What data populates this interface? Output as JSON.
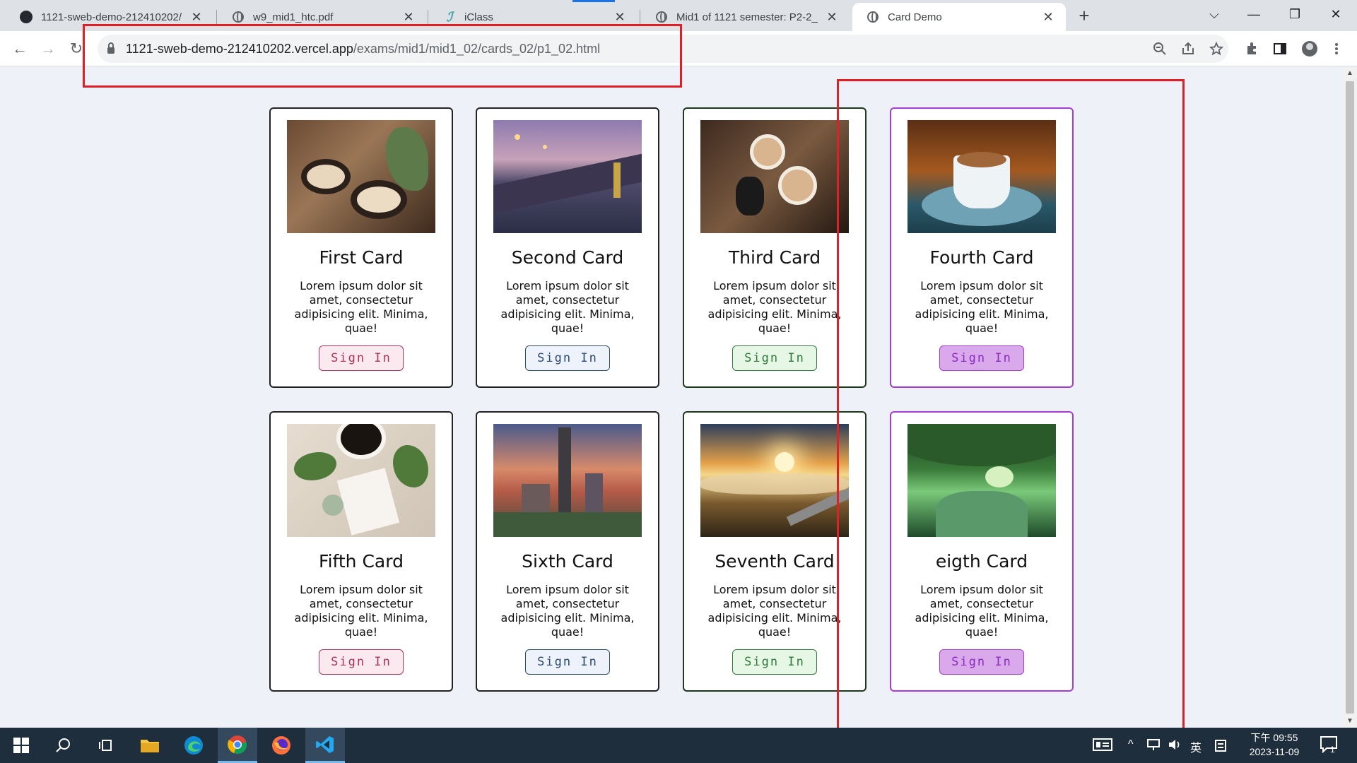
{
  "browser": {
    "tabs": [
      {
        "title": "1121-sweb-demo-212410202/",
        "icon": "github-icon",
        "close": "✕"
      },
      {
        "title": "w9_mid1_htc.pdf",
        "icon": "globe-icon",
        "close": "✕"
      },
      {
        "title": "iClass",
        "icon": "iclass-icon",
        "close": "✕"
      },
      {
        "title": "Mid1 of 1121 semester: P2-2_",
        "icon": "globe-icon",
        "close": "✕"
      },
      {
        "title": "Card Demo",
        "icon": "globe-icon",
        "close": "✕"
      }
    ],
    "new_tab": "+",
    "window_controls": {
      "dropdown": "⌵",
      "minimize": "—",
      "restore": "❐",
      "close": "✕"
    },
    "nav": {
      "back": "←",
      "forward": "→",
      "reload": "↻"
    },
    "url_host": "1121-sweb-demo-212410202.vercel.app",
    "url_path": "/exams/mid1/mid1_02/cards_02/p1_02.html",
    "toolbar_icons": [
      "zoom-icon",
      "share-icon",
      "star-icon",
      "extensions-icon",
      "sidepanel-icon",
      "profile-icon",
      "menu-icon"
    ]
  },
  "cards": [
    {
      "title": "First Card",
      "text": "Lorem ipsum dolor sit amet, consectetur adipisicing elit. Minima, quae!",
      "button": "Sign In",
      "variant": "pink",
      "photo": "coffee-cups"
    },
    {
      "title": "Second Card",
      "text": "Lorem ipsum dolor sit amet, consectetur adipisicing elit. Minima, quae!",
      "button": "Sign In",
      "variant": "blue",
      "photo": "bridge-evening"
    },
    {
      "title": "Third Card",
      "text": "Lorem ipsum dolor sit amet, consectetur adipisicing elit. Minima, quae!",
      "button": "Sign In",
      "variant": "green",
      "photo": "latte-toast"
    },
    {
      "title": "Fourth Card",
      "text": "Lorem ipsum dolor sit amet, consectetur adipisicing elit. Minima, quae!",
      "button": "Sign In",
      "variant": "purple",
      "photo": "coffee-cup-saucer"
    },
    {
      "title": "Fifth Card",
      "text": "Lorem ipsum dolor sit amet, consectetur adipisicing elit. Minima, quae!",
      "button": "Sign In",
      "variant": "pink",
      "photo": "coffee-flatlay"
    },
    {
      "title": "Sixth Card",
      "text": "Lorem ipsum dolor sit amet, consectetur adipisicing elit. Minima, quae!",
      "button": "Sign In",
      "variant": "blue",
      "photo": "city-skyline"
    },
    {
      "title": "Seventh Card",
      "text": "Lorem ipsum dolor sit amet, consectetur adipisicing elit. Minima, quae!",
      "button": "Sign In",
      "variant": "green",
      "photo": "mountain-sunrise"
    },
    {
      "title": "eigth Card",
      "text": "Lorem ipsum dolor sit amet, consectetur adipisicing elit. Minima, quae!",
      "button": "Sign In",
      "variant": "purple",
      "photo": "green-river"
    }
  ],
  "taskbar": {
    "apps": [
      "windows-start-icon",
      "search-icon",
      "task-view-icon",
      "file-explorer-icon",
      "edge-icon",
      "chrome-icon",
      "firefox-icon",
      "vscode-icon"
    ],
    "tray": {
      "ime_mode": "英",
      "chevron": "^"
    },
    "clock_time": "下午 09:55",
    "clock_date": "2023-11-09",
    "notification_count": "1"
  }
}
